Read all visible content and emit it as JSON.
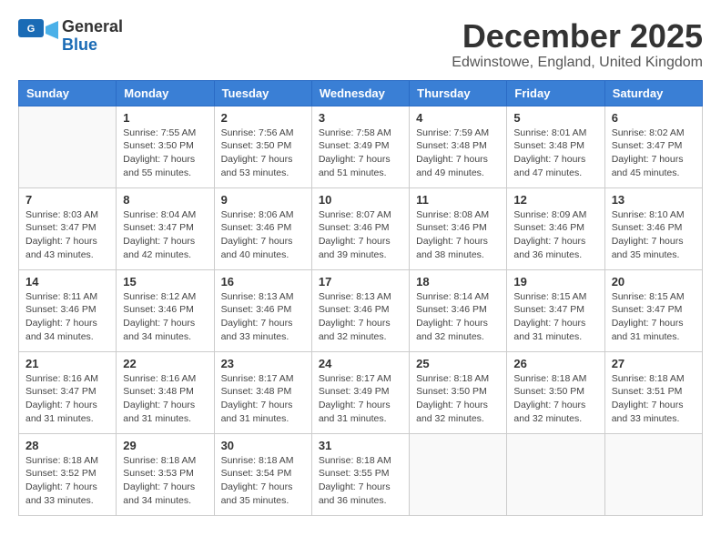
{
  "header": {
    "logo_line1": "General",
    "logo_line2": "Blue",
    "month": "December 2025",
    "location": "Edwinstowe, England, United Kingdom"
  },
  "weekdays": [
    "Sunday",
    "Monday",
    "Tuesday",
    "Wednesday",
    "Thursday",
    "Friday",
    "Saturday"
  ],
  "weeks": [
    [
      {
        "day": "",
        "sunrise": "",
        "sunset": "",
        "daylight": ""
      },
      {
        "day": "1",
        "sunrise": "Sunrise: 7:55 AM",
        "sunset": "Sunset: 3:50 PM",
        "daylight": "Daylight: 7 hours and 55 minutes."
      },
      {
        "day": "2",
        "sunrise": "Sunrise: 7:56 AM",
        "sunset": "Sunset: 3:50 PM",
        "daylight": "Daylight: 7 hours and 53 minutes."
      },
      {
        "day": "3",
        "sunrise": "Sunrise: 7:58 AM",
        "sunset": "Sunset: 3:49 PM",
        "daylight": "Daylight: 7 hours and 51 minutes."
      },
      {
        "day": "4",
        "sunrise": "Sunrise: 7:59 AM",
        "sunset": "Sunset: 3:48 PM",
        "daylight": "Daylight: 7 hours and 49 minutes."
      },
      {
        "day": "5",
        "sunrise": "Sunrise: 8:01 AM",
        "sunset": "Sunset: 3:48 PM",
        "daylight": "Daylight: 7 hours and 47 minutes."
      },
      {
        "day": "6",
        "sunrise": "Sunrise: 8:02 AM",
        "sunset": "Sunset: 3:47 PM",
        "daylight": "Daylight: 7 hours and 45 minutes."
      }
    ],
    [
      {
        "day": "7",
        "sunrise": "Sunrise: 8:03 AM",
        "sunset": "Sunset: 3:47 PM",
        "daylight": "Daylight: 7 hours and 43 minutes."
      },
      {
        "day": "8",
        "sunrise": "Sunrise: 8:04 AM",
        "sunset": "Sunset: 3:47 PM",
        "daylight": "Daylight: 7 hours and 42 minutes."
      },
      {
        "day": "9",
        "sunrise": "Sunrise: 8:06 AM",
        "sunset": "Sunset: 3:46 PM",
        "daylight": "Daylight: 7 hours and 40 minutes."
      },
      {
        "day": "10",
        "sunrise": "Sunrise: 8:07 AM",
        "sunset": "Sunset: 3:46 PM",
        "daylight": "Daylight: 7 hours and 39 minutes."
      },
      {
        "day": "11",
        "sunrise": "Sunrise: 8:08 AM",
        "sunset": "Sunset: 3:46 PM",
        "daylight": "Daylight: 7 hours and 38 minutes."
      },
      {
        "day": "12",
        "sunrise": "Sunrise: 8:09 AM",
        "sunset": "Sunset: 3:46 PM",
        "daylight": "Daylight: 7 hours and 36 minutes."
      },
      {
        "day": "13",
        "sunrise": "Sunrise: 8:10 AM",
        "sunset": "Sunset: 3:46 PM",
        "daylight": "Daylight: 7 hours and 35 minutes."
      }
    ],
    [
      {
        "day": "14",
        "sunrise": "Sunrise: 8:11 AM",
        "sunset": "Sunset: 3:46 PM",
        "daylight": "Daylight: 7 hours and 34 minutes."
      },
      {
        "day": "15",
        "sunrise": "Sunrise: 8:12 AM",
        "sunset": "Sunset: 3:46 PM",
        "daylight": "Daylight: 7 hours and 34 minutes."
      },
      {
        "day": "16",
        "sunrise": "Sunrise: 8:13 AM",
        "sunset": "Sunset: 3:46 PM",
        "daylight": "Daylight: 7 hours and 33 minutes."
      },
      {
        "day": "17",
        "sunrise": "Sunrise: 8:13 AM",
        "sunset": "Sunset: 3:46 PM",
        "daylight": "Daylight: 7 hours and 32 minutes."
      },
      {
        "day": "18",
        "sunrise": "Sunrise: 8:14 AM",
        "sunset": "Sunset: 3:46 PM",
        "daylight": "Daylight: 7 hours and 32 minutes."
      },
      {
        "day": "19",
        "sunrise": "Sunrise: 8:15 AM",
        "sunset": "Sunset: 3:47 PM",
        "daylight": "Daylight: 7 hours and 31 minutes."
      },
      {
        "day": "20",
        "sunrise": "Sunrise: 8:15 AM",
        "sunset": "Sunset: 3:47 PM",
        "daylight": "Daylight: 7 hours and 31 minutes."
      }
    ],
    [
      {
        "day": "21",
        "sunrise": "Sunrise: 8:16 AM",
        "sunset": "Sunset: 3:47 PM",
        "daylight": "Daylight: 7 hours and 31 minutes."
      },
      {
        "day": "22",
        "sunrise": "Sunrise: 8:16 AM",
        "sunset": "Sunset: 3:48 PM",
        "daylight": "Daylight: 7 hours and 31 minutes."
      },
      {
        "day": "23",
        "sunrise": "Sunrise: 8:17 AM",
        "sunset": "Sunset: 3:48 PM",
        "daylight": "Daylight: 7 hours and 31 minutes."
      },
      {
        "day": "24",
        "sunrise": "Sunrise: 8:17 AM",
        "sunset": "Sunset: 3:49 PM",
        "daylight": "Daylight: 7 hours and 31 minutes."
      },
      {
        "day": "25",
        "sunrise": "Sunrise: 8:18 AM",
        "sunset": "Sunset: 3:50 PM",
        "daylight": "Daylight: 7 hours and 32 minutes."
      },
      {
        "day": "26",
        "sunrise": "Sunrise: 8:18 AM",
        "sunset": "Sunset: 3:50 PM",
        "daylight": "Daylight: 7 hours and 32 minutes."
      },
      {
        "day": "27",
        "sunrise": "Sunrise: 8:18 AM",
        "sunset": "Sunset: 3:51 PM",
        "daylight": "Daylight: 7 hours and 33 minutes."
      }
    ],
    [
      {
        "day": "28",
        "sunrise": "Sunrise: 8:18 AM",
        "sunset": "Sunset: 3:52 PM",
        "daylight": "Daylight: 7 hours and 33 minutes."
      },
      {
        "day": "29",
        "sunrise": "Sunrise: 8:18 AM",
        "sunset": "Sunset: 3:53 PM",
        "daylight": "Daylight: 7 hours and 34 minutes."
      },
      {
        "day": "30",
        "sunrise": "Sunrise: 8:18 AM",
        "sunset": "Sunset: 3:54 PM",
        "daylight": "Daylight: 7 hours and 35 minutes."
      },
      {
        "day": "31",
        "sunrise": "Sunrise: 8:18 AM",
        "sunset": "Sunset: 3:55 PM",
        "daylight": "Daylight: 7 hours and 36 minutes."
      },
      {
        "day": "",
        "sunrise": "",
        "sunset": "",
        "daylight": ""
      },
      {
        "day": "",
        "sunrise": "",
        "sunset": "",
        "daylight": ""
      },
      {
        "day": "",
        "sunrise": "",
        "sunset": "",
        "daylight": ""
      }
    ]
  ]
}
